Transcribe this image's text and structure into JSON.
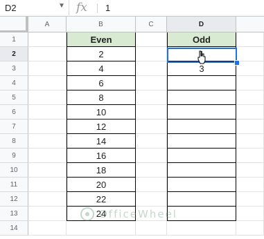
{
  "formula_bar": {
    "cell_ref": "D2",
    "fx_label": "fx",
    "formula_value": "1"
  },
  "columns": [
    "A",
    "B",
    "C",
    "D"
  ],
  "rows": [
    "1",
    "2",
    "3",
    "4",
    "5",
    "6",
    "7",
    "8",
    "9",
    "10",
    "11",
    "12",
    "13",
    "14"
  ],
  "table_even": {
    "header": "Even",
    "values": [
      "2",
      "4",
      "6",
      "8",
      "10",
      "12",
      "14",
      "16",
      "18",
      "20",
      "22",
      "24"
    ]
  },
  "table_odd": {
    "header": "Odd",
    "values": [
      "1",
      "3",
      "",
      "",
      "",
      "",
      "",
      "",
      "",
      "",
      "",
      ""
    ]
  },
  "selected_cell": "D2",
  "colors": {
    "header_fill": "#d9ead3",
    "selection": "#1a73e8"
  },
  "watermark": {
    "text": "OfficeWheel"
  }
}
